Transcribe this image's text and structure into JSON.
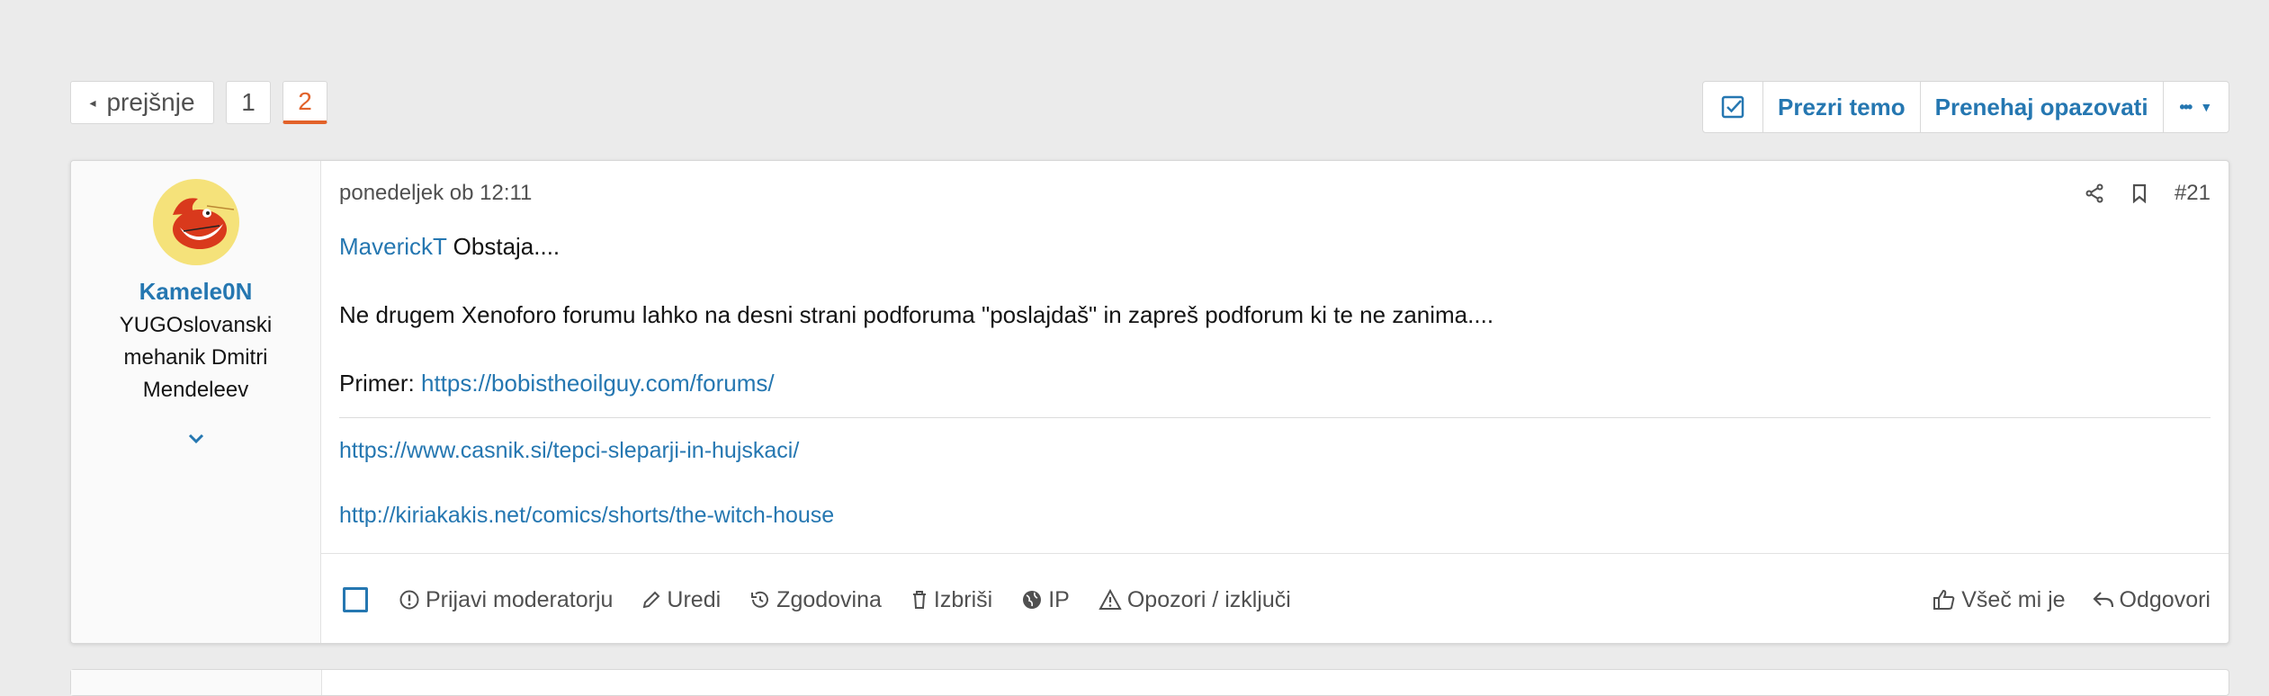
{
  "pagination": {
    "prev_label": "prejšnje",
    "pages": [
      "1",
      "2"
    ],
    "current_page": "2"
  },
  "thread_actions": {
    "ignore_label": "Prezri temo",
    "unwatch_label": "Prenehaj opazovati",
    "more_label": "•••"
  },
  "post": {
    "user": {
      "name": "Kamele0N",
      "title": "YUGOslovanski mehanik Dmitri Mendeleev"
    },
    "timestamp": "ponedeljek ob 12:11",
    "number": "#21",
    "mention": "MaverickT",
    "line1_rest": " Obstaja....",
    "line2": "Ne drugem Xenoforo forumu lahko na desni strani podforuma \"poslajdaš\" in zapreš podforum ki te ne zanima....",
    "line3_prefix": "Primer: ",
    "line3_link": "https://bobistheoilguy.com/forums/",
    "signature_links": [
      "https://www.casnik.si/tepci-sleparji-in-hujskaci/",
      "http://kiriakakis.net/comics/shorts/the-witch-house"
    ]
  },
  "footer_actions": {
    "report": "Prijavi moderatorju",
    "edit": "Uredi",
    "history": "Zgodovina",
    "delete": "Izbriši",
    "ip": "IP",
    "warn": "Opozori / izključi",
    "like": "Všeč mi je",
    "reply": "Odgovori"
  },
  "colors": {
    "accent": "#2577b1",
    "current_page": "#e2622a",
    "background": "#ebebeb"
  }
}
